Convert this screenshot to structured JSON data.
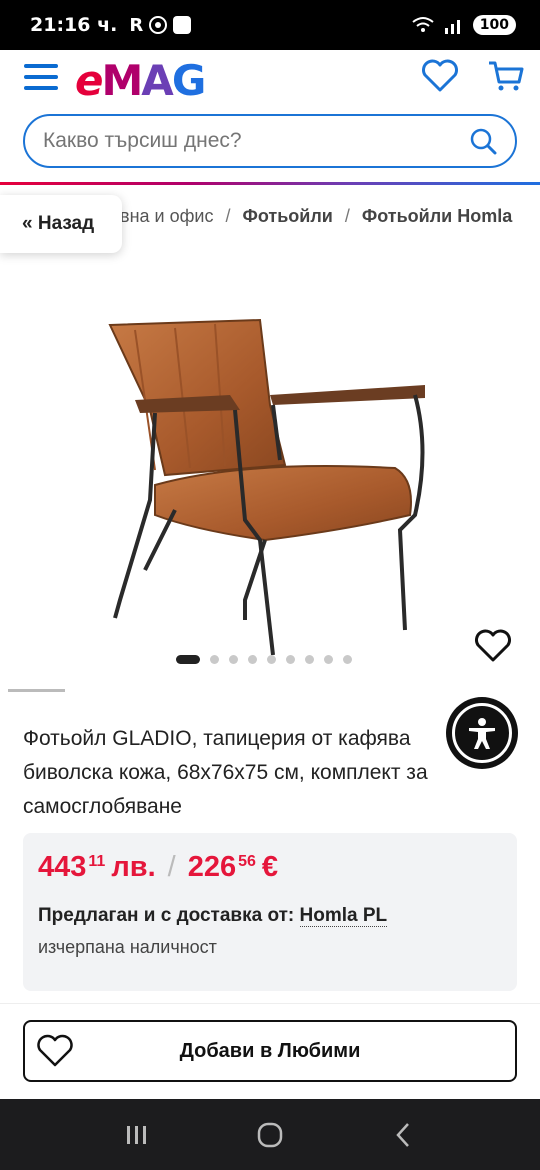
{
  "status": {
    "time": "21:16 ч.",
    "r_letter": "R",
    "battery": "100"
  },
  "search": {
    "placeholder": "Какво търсиш днес?"
  },
  "logo": {
    "e": "e",
    "m": "M",
    "a": "A",
    "g": "G"
  },
  "back": {
    "label": "« Назад"
  },
  "breadcrumb": {
    "item1": "вна и офис",
    "sep": "/",
    "item2": "Фотьойли",
    "item3": "Фотьойли Homla"
  },
  "carousel": {
    "total_images": 9,
    "active_index": 0
  },
  "product": {
    "title": "Фотьойл GLADIO, тапицерия от кафява биволска кожа, 68x76x75 см, комплект за самосглобяване",
    "price_bgn": "443",
    "price_bgn_cents": "11",
    "price_bgn_unit": "лв.",
    "price_sep": "/",
    "price_eur": "226",
    "price_eur_cents": "56",
    "price_eur_unit": "€",
    "seller_label": "Предлаган и с доставка от:",
    "seller_name": "Homla PL",
    "stock": "изчерпана наличност"
  },
  "actions": {
    "add_favorites": "Добави в Любими"
  },
  "colors": {
    "accent": "#1b74d6",
    "price": "#e5163b",
    "brand_red": "#e5003b",
    "brand_blue": "#1f6fe0"
  },
  "icons": [
    "menu-icon",
    "heart-icon",
    "cart-icon",
    "search-icon",
    "accessibility-icon",
    "recent-apps-icon",
    "home-icon",
    "back-icon"
  ]
}
